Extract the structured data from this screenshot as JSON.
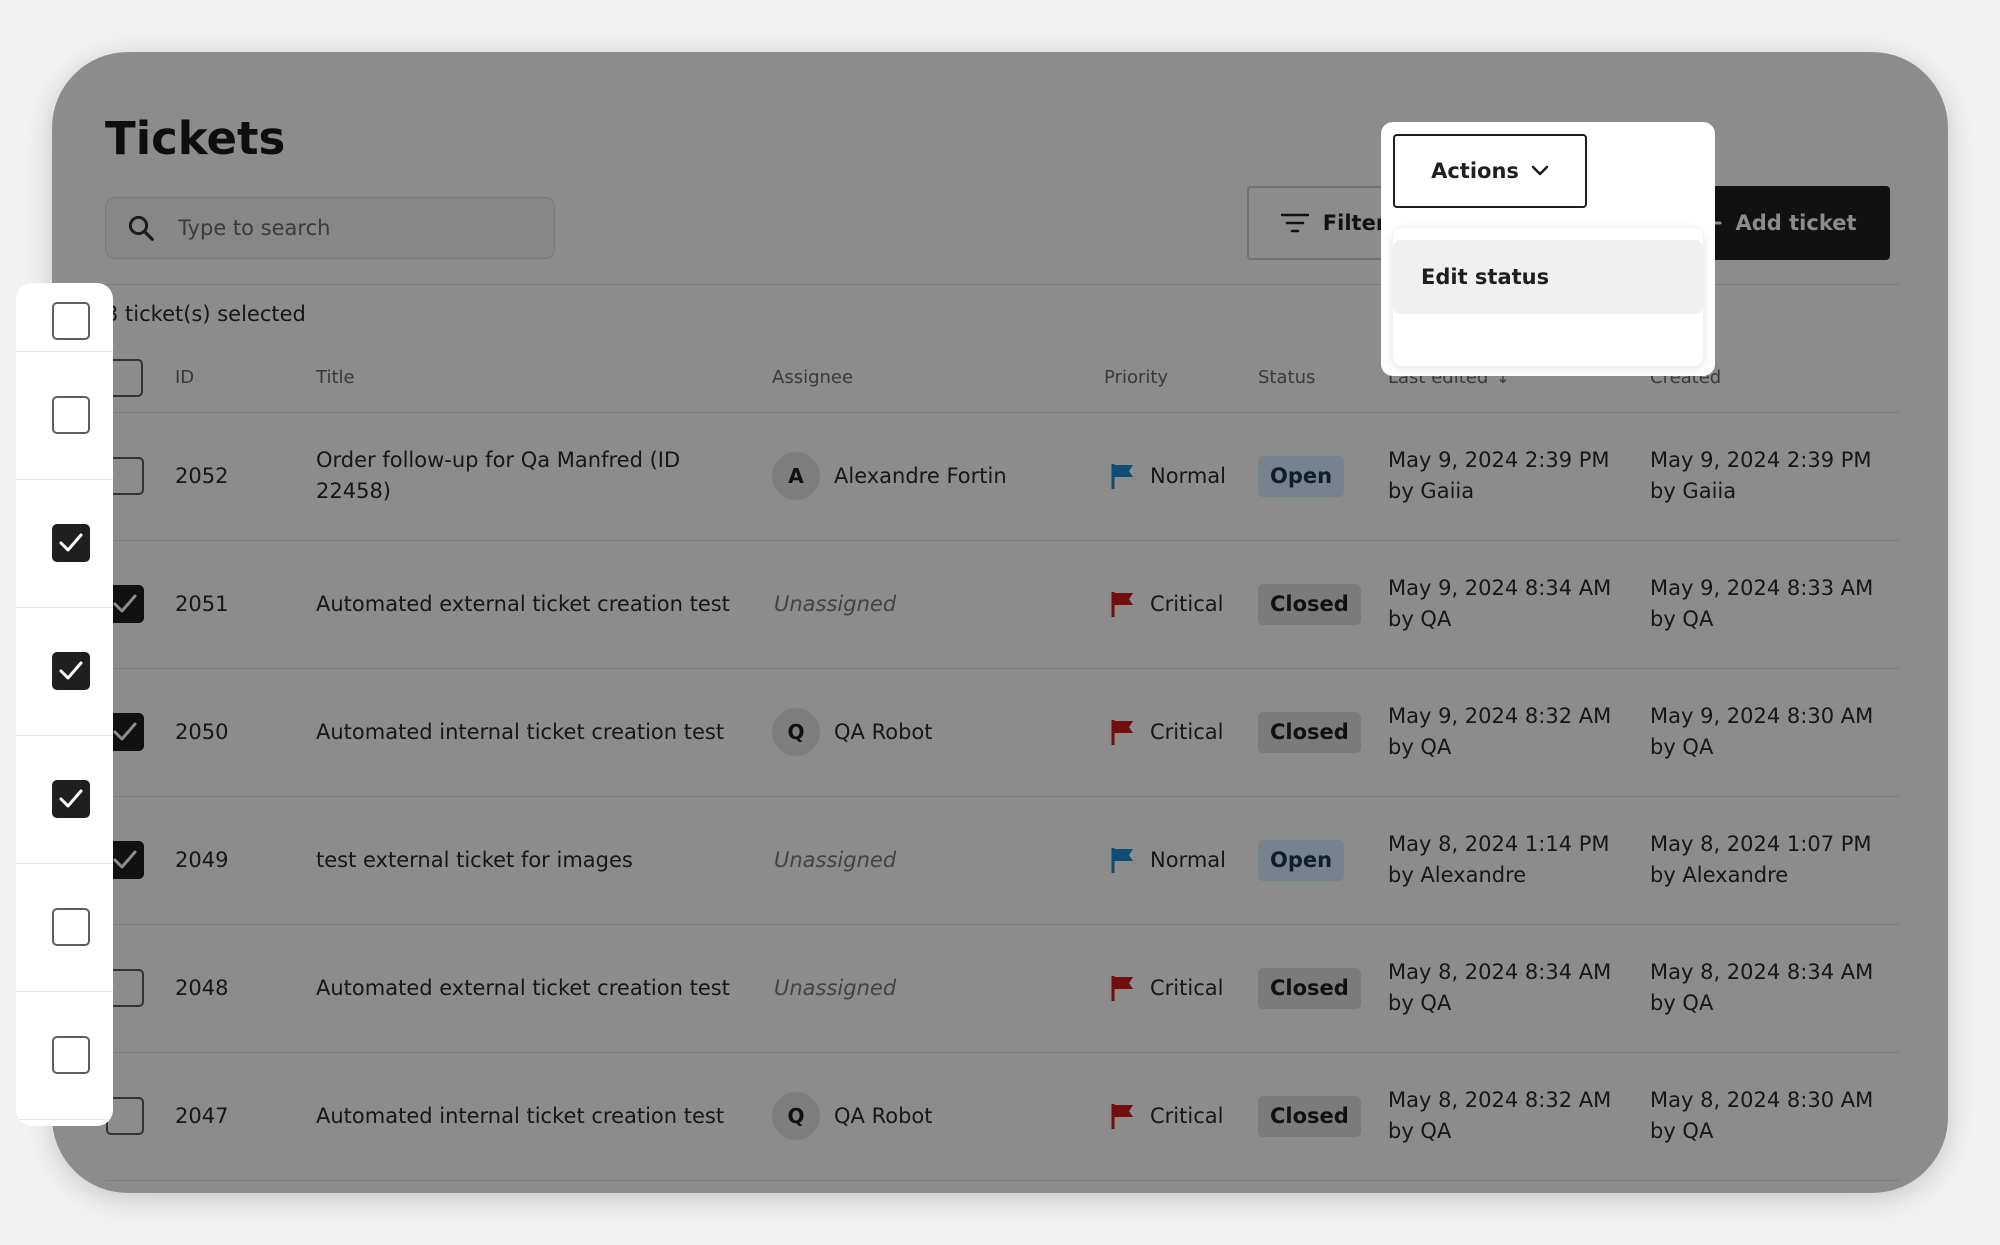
{
  "header": {
    "title": "Tickets"
  },
  "search": {
    "placeholder": "Type to search"
  },
  "toolbar": {
    "filter_label": "Filter",
    "actions_label": "Actions",
    "add_label": "Add ticket"
  },
  "actions_menu": {
    "items": [
      {
        "label": "Edit status"
      }
    ]
  },
  "selection": {
    "count_text": "3 ticket(s) selected"
  },
  "table": {
    "columns": {
      "id": "ID",
      "title": "Title",
      "assignee": "Assignee",
      "priority": "Priority",
      "status": "Status",
      "last_edited": "Last edited",
      "created": "Created"
    },
    "rows": [
      {
        "checked": false,
        "id": "2052",
        "title": "Order follow-up for Qa Manfred (ID 22458)",
        "avatar": "A",
        "assignee": "Alexandre Fortin",
        "unassigned": "",
        "priority": "Normal",
        "status": "Open",
        "edited_date": "May 9, 2024 2:39 PM",
        "edited_by": "by Gaiia",
        "created_date": "May 9, 2024 2:39 PM",
        "created_by": "by Gaiia"
      },
      {
        "checked": true,
        "id": "2051",
        "title": "Automated external ticket creation test",
        "avatar": "",
        "assignee": "",
        "unassigned": "Unassigned",
        "priority": "Critical",
        "status": "Closed",
        "edited_date": "May 9, 2024 8:34 AM",
        "edited_by": "by QA",
        "created_date": "May 9, 2024 8:33 AM",
        "created_by": "by QA"
      },
      {
        "checked": true,
        "id": "2050",
        "title": "Automated internal ticket creation test",
        "avatar": "Q",
        "assignee": "QA Robot",
        "unassigned": "",
        "priority": "Critical",
        "status": "Closed",
        "edited_date": "May 9, 2024 8:32 AM",
        "edited_by": "by QA",
        "created_date": "May 9, 2024 8:30 AM",
        "created_by": "by QA"
      },
      {
        "checked": true,
        "id": "2049",
        "title": "test external ticket for images",
        "avatar": "",
        "assignee": "",
        "unassigned": "Unassigned",
        "priority": "Normal",
        "status": "Open",
        "edited_date": "May 8, 2024 1:14 PM",
        "edited_by": "by Alexandre",
        "created_date": "May 8, 2024 1:07 PM",
        "created_by": "by Alexandre"
      },
      {
        "checked": false,
        "id": "2048",
        "title": "Automated external ticket creation test",
        "avatar": "",
        "assignee": "",
        "unassigned": "Unassigned",
        "priority": "Critical",
        "status": "Closed",
        "edited_date": "May 8, 2024 8:34 AM",
        "edited_by": "by QA",
        "created_date": "May 8, 2024 8:34 AM",
        "created_by": "by QA"
      },
      {
        "checked": false,
        "id": "2047",
        "title": "Automated internal ticket creation test",
        "avatar": "Q",
        "assignee": "QA Robot",
        "unassigned": "",
        "priority": "Critical",
        "status": "Closed",
        "edited_date": "May 8, 2024 8:32 AM",
        "edited_by": "by QA",
        "created_date": "May 8, 2024 8:30 AM",
        "created_by": "by QA"
      }
    ]
  },
  "icons": {
    "search": "search-icon",
    "filter": "filter-icon",
    "chevron": "chevron-down-icon",
    "plus": "plus-icon",
    "flag": "flag-icon",
    "check": "check-icon",
    "sort": "sort-arrow-icon"
  },
  "colors": {
    "primary": "#1f1f1f",
    "flag_normal": "#1c8fd1",
    "flag_critical": "#c81e1e",
    "badge_open_bg": "#d6efff",
    "badge_closed_bg": "#e0e0e0"
  }
}
